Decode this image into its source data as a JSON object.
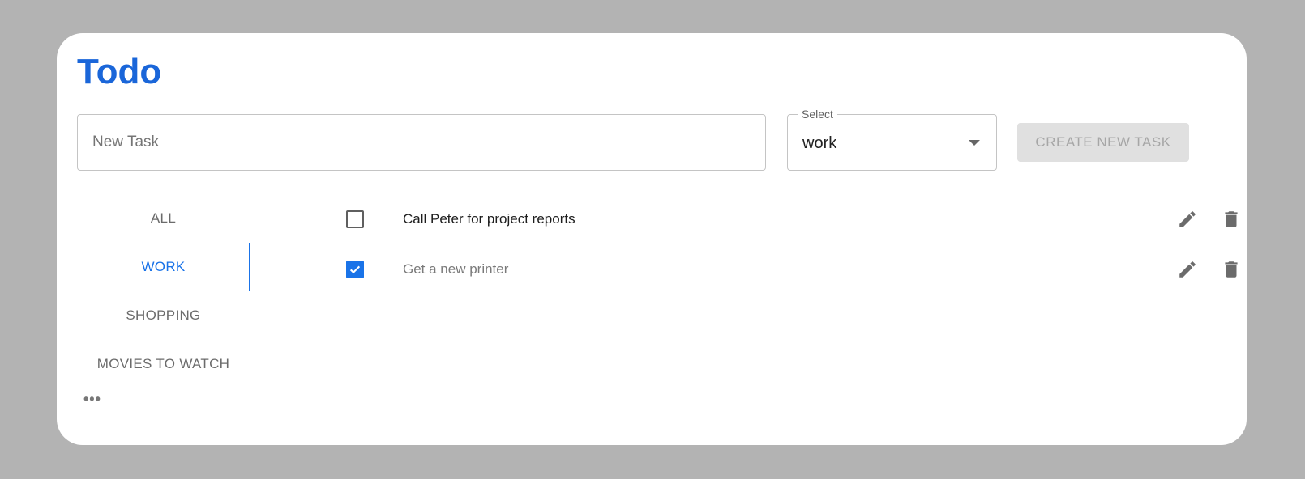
{
  "app": {
    "title": "Todo"
  },
  "new_task": {
    "placeholder": "New Task",
    "value": ""
  },
  "select": {
    "label": "Select",
    "value": "work"
  },
  "create_button": {
    "label": "CREATE NEW TASK",
    "disabled": true
  },
  "tabs": [
    {
      "label": "ALL",
      "active": false
    },
    {
      "label": "WORK",
      "active": true
    },
    {
      "label": "SHOPPING",
      "active": false
    },
    {
      "label": "MOVIES TO WATCH",
      "active": false
    }
  ],
  "more": {
    "label": "•••"
  },
  "tasks": [
    {
      "text": "Call Peter for project reports",
      "done": false
    },
    {
      "text": "Get a new printer",
      "done": true
    }
  ],
  "icons": {
    "checkbox_unchecked": "checkbox-outline-icon",
    "checkbox_checked": "checkbox-checked-icon",
    "edit": "pencil-icon",
    "delete": "trash-icon",
    "dropdown": "caret-down-icon"
  },
  "colors": {
    "background": "#b3b3b3",
    "card": "#ffffff",
    "title": "#1a66d9",
    "accent": "#1a73e8",
    "button_disabled_bg": "#e0e0e0",
    "button_disabled_text": "#a6a6a6",
    "icon": "#6b6b6b"
  }
}
